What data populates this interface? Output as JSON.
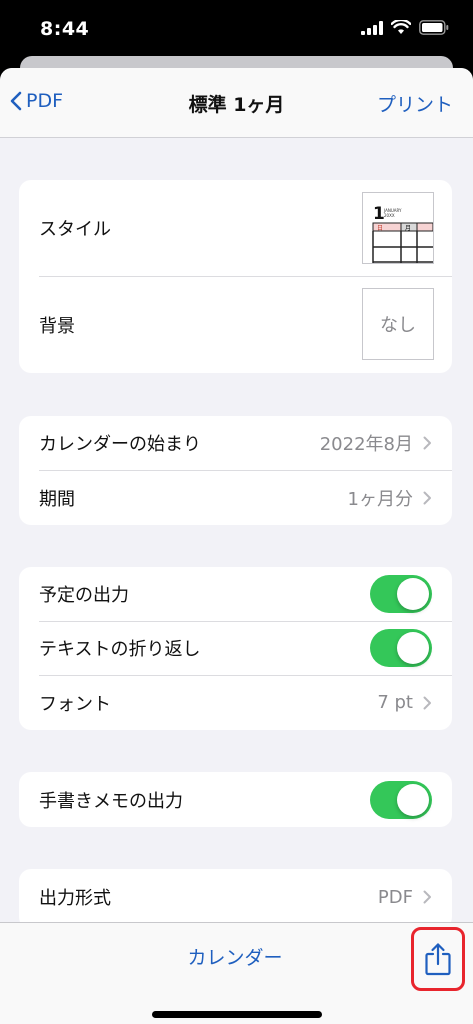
{
  "status": {
    "time": "8:44"
  },
  "nav": {
    "back_label": "PDF",
    "title": "標準 1ヶ月",
    "action_label": "プリント"
  },
  "group1": {
    "style_label": "スタイル",
    "style_thumb": {
      "day_number": "1",
      "month_tag": "JANUARY",
      "year_tag": "20XX",
      "header_cells": [
        "日",
        "月"
      ]
    },
    "background_label": "背景",
    "background_value": "なし"
  },
  "group2": {
    "start_label": "カレンダーの始まり",
    "start_value": "2022年8月",
    "period_label": "期間",
    "period_value": "1ヶ月分"
  },
  "group3": {
    "output_label": "予定の出力",
    "output_on": true,
    "wrap_label": "テキストの折り返し",
    "wrap_on": true,
    "font_label": "フォント",
    "font_value": "7 pt"
  },
  "group4": {
    "memo_label": "手書きメモの出力",
    "memo_on": true
  },
  "group5": {
    "format_label": "出力形式",
    "format_value": "PDF"
  },
  "toolbar": {
    "calendar_label": "カレンダー"
  },
  "colors": {
    "accent": "#1f5fbf",
    "toggle_on": "#34c759",
    "highlight": "#e8252d"
  }
}
